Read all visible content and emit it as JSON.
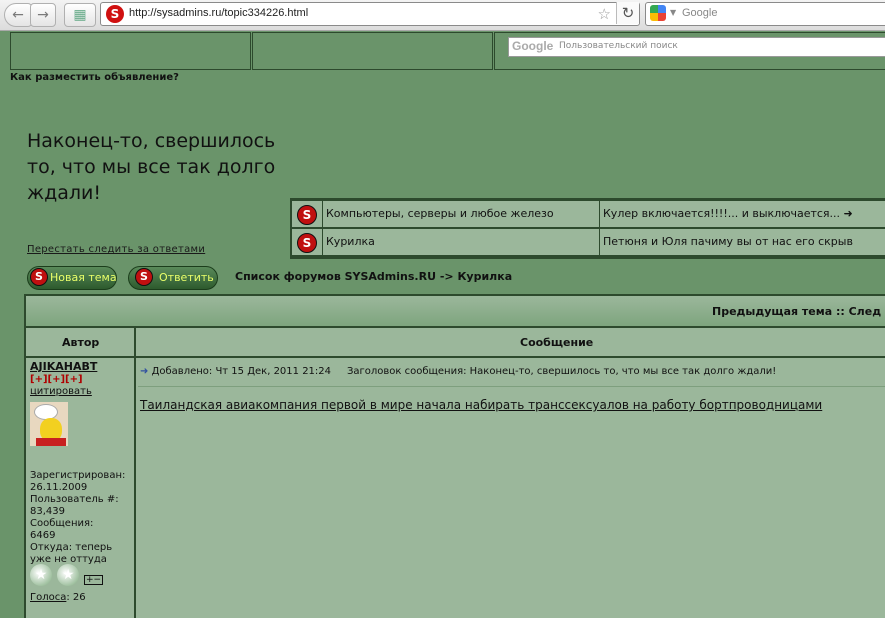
{
  "browser": {
    "url": "http://sysadmins.ru/topic334226.html",
    "search_placeholder": "Google"
  },
  "header": {
    "custom_search_placeholder": "Пользовательский поиск",
    "google_logo": "Google",
    "ad_link": "Как разместить объявление?"
  },
  "topic": {
    "title": "Наконец-то, свершилось то, что мы все так долго ждали!",
    "unwatch_link": "Перестать следить за ответами"
  },
  "related_topics": [
    {
      "forum": "Компьютеры, серверы и любое железо",
      "topic": "Кулер включается!!!!... и выключается... ➜"
    },
    {
      "forum": "Курилка",
      "topic": "Петюня и Юля пачиму вы от нас его скрыв"
    }
  ],
  "actions": {
    "new_topic_label": "Новая тема",
    "reply_label": "Ответить"
  },
  "breadcrumb": "Список форумов SYSAdmins.RU -> Курилка",
  "table": {
    "nav_text": "Предыдущая тема :: След",
    "col_author": "Автор",
    "col_message": "Сообщение"
  },
  "post": {
    "author": "AJIKAHABT",
    "plus_marks": "[+][+][+]",
    "quote_label": "цитировать",
    "registered_label": "Зарегистрирован:",
    "registered_date": "26.11.2009",
    "user_no_label": "Пользователь #:",
    "user_no": "83,439",
    "messages_label": "Сообщения:",
    "messages_count": "6469",
    "from_label": "Откуда: теперь",
    "from_value": "уже не оттуда",
    "votes_label": "Голоса",
    "votes_value": ": 26",
    "pm_icon_text": "+−",
    "meta_added": "Добавлено: Чт 15 Дек, 2011 21:24",
    "meta_subject": "Заголовок сообщения: Наконец-то, свершилось то, что мы все так долго ждали!",
    "link_text": "Таиландская авиакомпания первой в мире начала набирать транссексуалов на работу бортпроводницами"
  }
}
